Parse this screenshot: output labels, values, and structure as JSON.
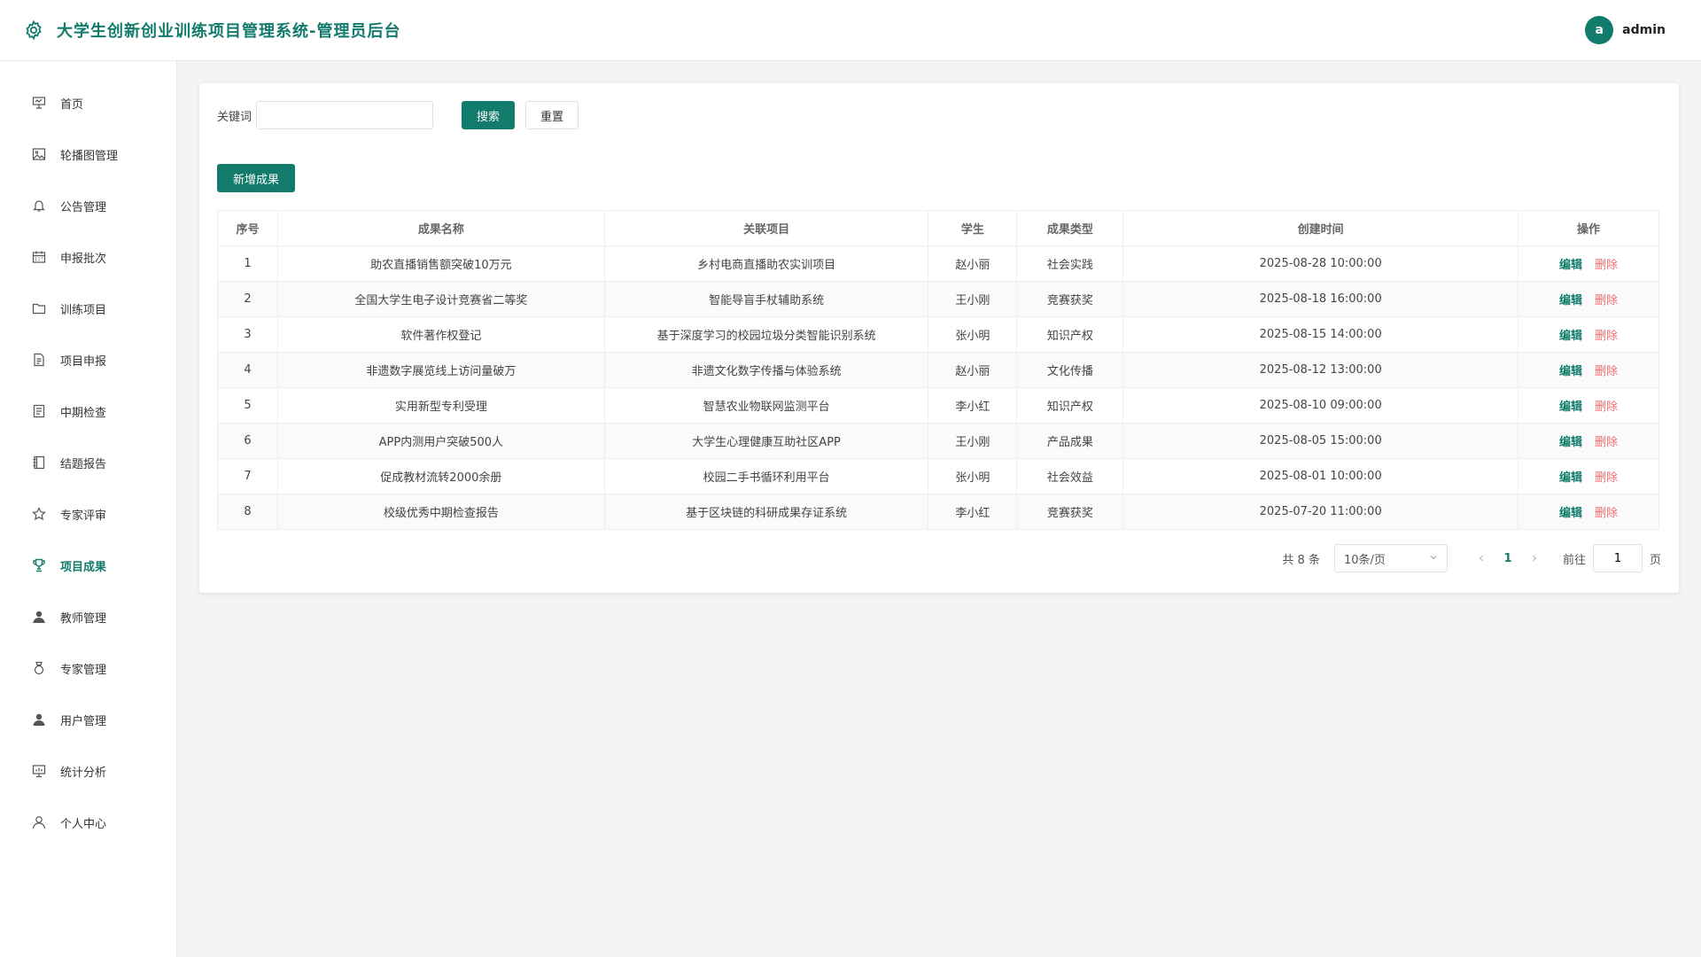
{
  "header": {
    "title": "大学生创新创业训练项目管理系统-管理员后台",
    "avatar_letter": "a",
    "username": "admin"
  },
  "colors": {
    "accent": "#127b6c",
    "danger": "#f56c6c"
  },
  "sidebar": {
    "items": [
      {
        "label": "首页",
        "icon": "presentation-icon"
      },
      {
        "label": "轮播图管理",
        "icon": "image-icon"
      },
      {
        "label": "公告管理",
        "icon": "bell-icon"
      },
      {
        "label": "申报批次",
        "icon": "calendar-icon"
      },
      {
        "label": "训练项目",
        "icon": "folder-icon"
      },
      {
        "label": "项目申报",
        "icon": "document-icon"
      },
      {
        "label": "中期检查",
        "icon": "tickets-icon"
      },
      {
        "label": "结题报告",
        "icon": "notebook-icon"
      },
      {
        "label": "专家评审",
        "icon": "star-icon"
      },
      {
        "label": "项目成果",
        "icon": "trophy-icon"
      },
      {
        "label": "教师管理",
        "icon": "user-solid-icon"
      },
      {
        "label": "专家管理",
        "icon": "medal-icon"
      },
      {
        "label": "用户管理",
        "icon": "user-solid-icon"
      },
      {
        "label": "统计分析",
        "icon": "data-board-icon"
      },
      {
        "label": "个人中心",
        "icon": "user-icon"
      }
    ]
  },
  "search": {
    "keyword_label": "关键词",
    "keyword_value": "",
    "search_label": "搜索",
    "reset_label": "重置"
  },
  "toolbar": {
    "add_label": "新增成果"
  },
  "table": {
    "headers": [
      "序号",
      "成果名称",
      "关联项目",
      "学生",
      "成果类型",
      "创建时间",
      "操作"
    ],
    "edit_label": "编辑",
    "delete_label": "删除",
    "rows": [
      [
        "1",
        "助农直播销售额突破10万元",
        "乡村电商直播助农实训项目",
        "赵小丽",
        "社会实践",
        "2025-08-28 10:00:00"
      ],
      [
        "2",
        "全国大学生电子设计竞赛省二等奖",
        "智能导盲手杖辅助系统",
        "王小刚",
        "竞赛获奖",
        "2025-08-18 16:00:00"
      ],
      [
        "3",
        "软件著作权登记",
        "基于深度学习的校园垃圾分类智能识别系统",
        "张小明",
        "知识产权",
        "2025-08-15 14:00:00"
      ],
      [
        "4",
        "非遗数字展览线上访问量破万",
        "非遗文化数字传播与体验系统",
        "赵小丽",
        "文化传播",
        "2025-08-12 13:00:00"
      ],
      [
        "5",
        "实用新型专利受理",
        "智慧农业物联网监测平台",
        "李小红",
        "知识产权",
        "2025-08-10 09:00:00"
      ],
      [
        "6",
        "APP内测用户突破500人",
        "大学生心理健康互助社区APP",
        "王小刚",
        "产品成果",
        "2025-08-05 15:00:00"
      ],
      [
        "7",
        "促成教材流转2000余册",
        "校园二手书循环利用平台",
        "张小明",
        "社会效益",
        "2025-08-01 10:00:00"
      ],
      [
        "8",
        "校级优秀中期检查报告",
        "基于区块链的科研成果存证系统",
        "李小红",
        "竞赛获奖",
        "2025-07-20 11:00:00"
      ]
    ]
  },
  "pagination": {
    "total_text": "共 8 条",
    "page_size": "10条/页",
    "current_page": "1",
    "goto_label": "前往",
    "goto_value": "1",
    "page_suffix": "页"
  }
}
